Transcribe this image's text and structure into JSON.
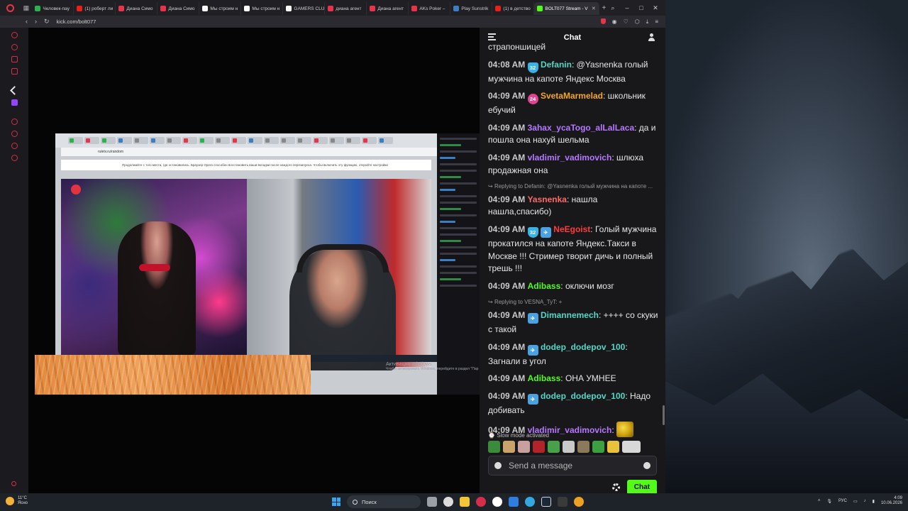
{
  "browser": {
    "tabs": [
      {
        "label": "Человек-пау",
        "color": "#2bb24c"
      },
      {
        "label": "(1) роберт ли",
        "color": "#e62117"
      },
      {
        "label": "Диана Симо",
        "color": "#e8344a"
      },
      {
        "label": "Диана Симо",
        "color": "#e8344a"
      },
      {
        "label": "Мы строим н",
        "color": "#ffffff"
      },
      {
        "label": "Мы строим н",
        "color": "#ffffff"
      },
      {
        "label": "GAMERS CLU",
        "color": "#ffffff"
      },
      {
        "label": "диана агент",
        "color": "#e8344a"
      },
      {
        "label": "Диана агент",
        "color": "#e8344a"
      },
      {
        "label": "AKs Poker –",
        "color": "#e8344a"
      },
      {
        "label": "Play Sunstrik",
        "color": "#3a7fc4"
      },
      {
        "label": "(1) в детство",
        "color": "#e62117"
      }
    ],
    "active_tab": {
      "label": "BOLT077 Stream - V",
      "color": "#53fc18"
    },
    "url": "kick.com/bolt077",
    "window_controls": [
      "–",
      "□",
      "✕"
    ]
  },
  "video": {
    "embedded_url": "ruletv.ru/random",
    "embedded_banner": "Продолжайте с того места, где остановились. Браузер Opera способен восстановить ваши вкладки после каждого перезапуска. Чтобы включить эту функцию, откройте настройки",
    "activation_title": "Активация Windows",
    "activation_sub": "Чтобы активировать Windows, перейдите в раздел \"Пар"
  },
  "chat": {
    "title": "Chat",
    "partial_message": "страпоншицей",
    "messages": [
      {
        "time": "04:08 AM",
        "badges": [
          {
            "kind": "sub",
            "text": "32"
          }
        ],
        "user": "Defanin",
        "color": "#53d6c6",
        "text": ": @Yasnenka голый мужчина на капоте Яндекс Москва"
      },
      {
        "time": "04:09 AM",
        "badges": [
          {
            "kind": "pink",
            "text": "24"
          }
        ],
        "user": "SvetaMarmelad",
        "color": "#f5a623",
        "text": ": школьник ебучий"
      },
      {
        "time": "04:09 AM",
        "badges": [],
        "user": "3ahax_ycaTogo_alLalLaca",
        "color": "#b678ff",
        "text": ": да и пошла она нахуй шельма"
      },
      {
        "time": "04:09 AM",
        "badges": [],
        "user": "vladimir_vadimovich",
        "color": "#b678ff",
        "text": ": шлюха продажная она"
      },
      {
        "reply": "Replying to Defanin: @Yasnenka голый мужчина на капоте ...",
        "time": "04:09 AM",
        "badges": [],
        "user": "Yasnenka",
        "color": "#ff6a6a",
        "text": ": нашла нашла,спасибо)"
      },
      {
        "time": "04:09 AM",
        "badges": [
          {
            "kind": "sub",
            "text": "32"
          },
          {
            "kind": "og",
            "text": "✈"
          }
        ],
        "user": "NeEgoist",
        "color": "#ff3b3b",
        "text": ": Голый мужчина прокатился на капоте Яндекс.Такси в Москве !!! Стример творит дичь и полный трешь !!!"
      },
      {
        "time": "04:09 AM",
        "badges": [],
        "user": "Adibass",
        "color": "#53fc18",
        "text": ": оключи мозг"
      },
      {
        "reply": "Replying to VESNA_TyT: +",
        "time": "04:09 AM",
        "badges": [
          {
            "kind": "og",
            "text": "✈"
          }
        ],
        "user": "Dimannemech",
        "color": "#53d6c6",
        "text": ": ++++ со скуки с такой"
      },
      {
        "time": "04:09 AM",
        "badges": [
          {
            "kind": "og",
            "text": "✈"
          }
        ],
        "user": "dodep_dodepov_100",
        "color": "#53d6c6",
        "text": ": Загнали в угол"
      },
      {
        "time": "04:09 AM",
        "badges": [],
        "user": "Adibass",
        "color": "#53fc18",
        "text": ": ОНА УМНЕЕ"
      },
      {
        "time": "04:09 AM",
        "badges": [
          {
            "kind": "og",
            "text": "✈"
          }
        ],
        "user": "dodep_dodepov_100",
        "color": "#53d6c6",
        "text": ": Надо добивать"
      },
      {
        "time": "04:09 AM",
        "badges": [],
        "user": "vladimir_vadimovich",
        "color": "#b678ff",
        "text": ": ",
        "emote": "yellow-emote"
      }
    ],
    "slow_mode": "Slow mode activated",
    "emote_colors": [
      "#3a8c3a",
      "#c9a46a",
      "#c9a0a0",
      "#b3242a",
      "#48a048",
      "#c9c9c9",
      "#8a7a5a",
      "#3aa040",
      "#e8c23a",
      "#d8d8d8"
    ],
    "input_placeholder": "Send a message",
    "send_label": "Chat"
  },
  "taskbar": {
    "weather_temp": "11°C",
    "weather_desc": "Ясно",
    "search_label": "Поиск",
    "lang": "РУС",
    "time": "4:09",
    "date": "10.06.2026"
  }
}
